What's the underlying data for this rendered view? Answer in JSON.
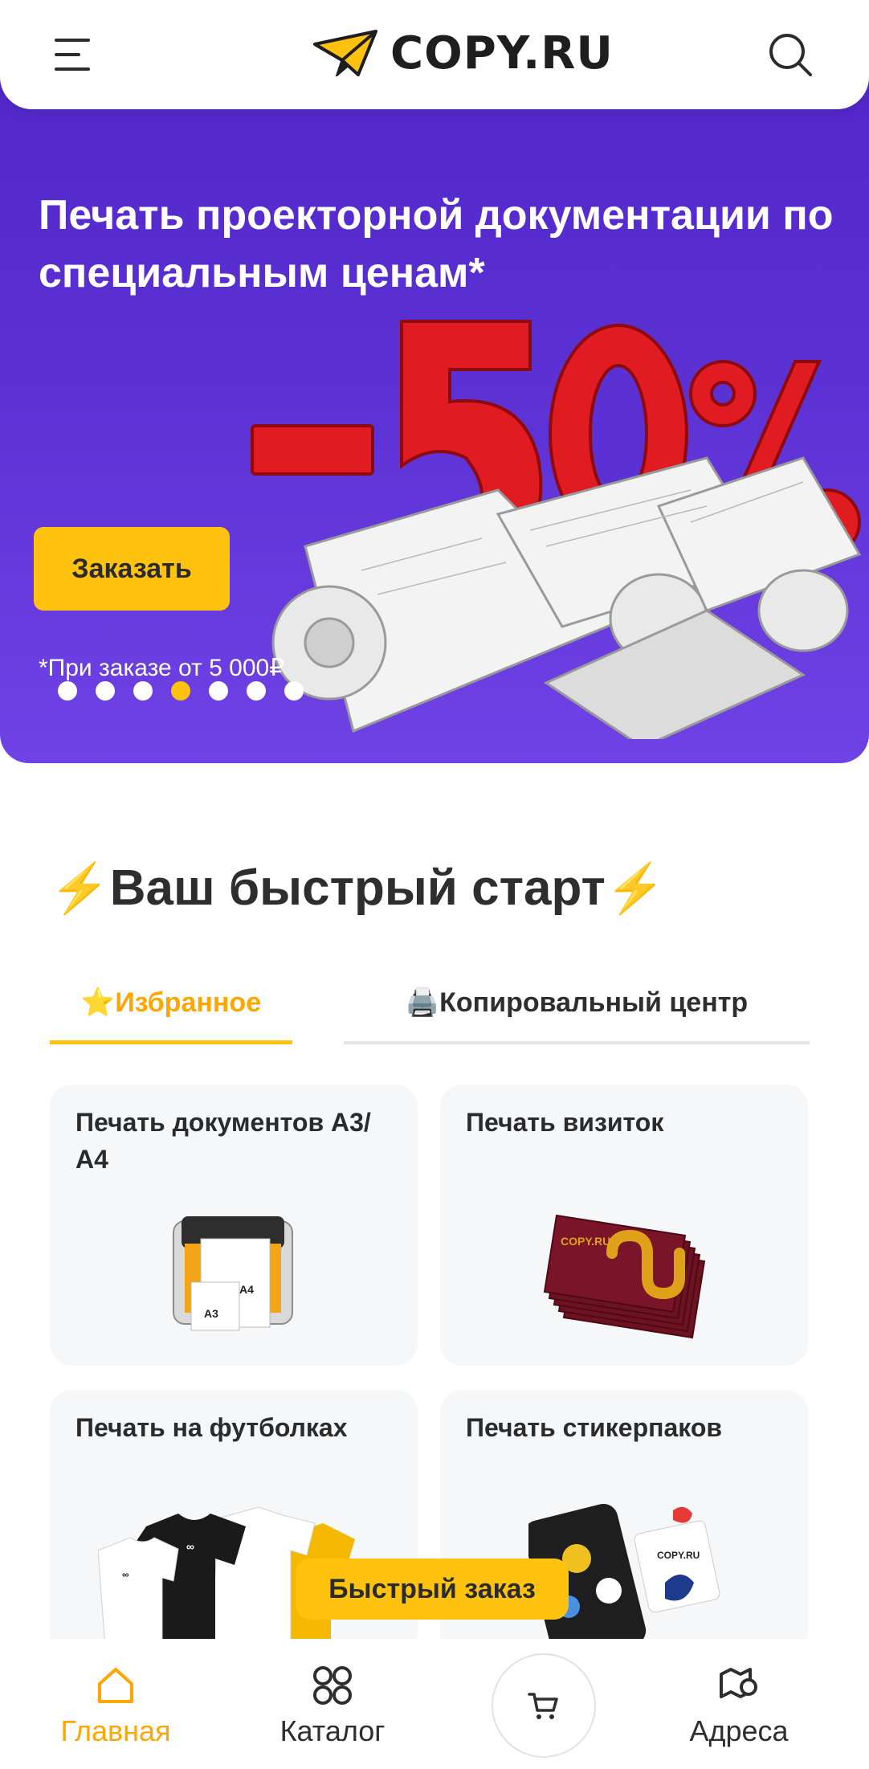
{
  "header": {
    "logo_text": "COPY.RU"
  },
  "banner": {
    "title": "Печать проекторной документации по специальным ценам*",
    "order_button": "Заказать",
    "note": "*При заказе от 5 000₽",
    "slides_count": 7,
    "active_slide": 4
  },
  "quick_start": {
    "title": "Ваш быстрый старт",
    "tabs": [
      {
        "label": "⭐Избранное",
        "active": true
      },
      {
        "label": "🖨️Копировальный центр",
        "active": false
      }
    ],
    "cards": [
      {
        "title": "Печать документов А3/А4"
      },
      {
        "title": "Печать визиток"
      },
      {
        "title": "Печать на футболках"
      },
      {
        "title": "Печать стикерпаков"
      }
    ]
  },
  "quick_order_button": "Быстрый заказ",
  "bottom_nav": {
    "items": [
      {
        "label": "Главная",
        "icon": "home-icon",
        "active": true
      },
      {
        "label": "Каталог",
        "icon": "catalog-icon",
        "active": false
      },
      {
        "label": "",
        "icon": "cart-icon",
        "active": false
      },
      {
        "label": "Адреса",
        "icon": "map-icon",
        "active": false
      }
    ]
  },
  "colors": {
    "accent": "#ffc20e",
    "active_text": "#ffa600",
    "banner_bg": "#5c31d4",
    "card_bg": "#f6f7f9"
  }
}
